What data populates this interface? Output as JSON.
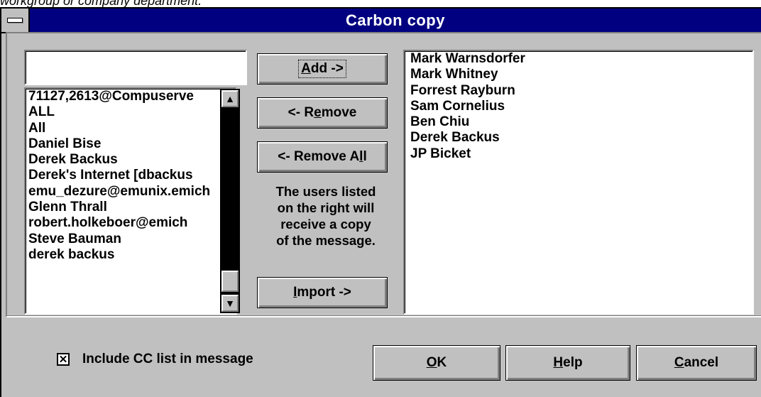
{
  "caption": "workgroup or company department.",
  "window": {
    "title": "Carbon copy"
  },
  "name_input": {
    "value": ""
  },
  "available_list": {
    "items": [
      "71127,2613@Compuserve",
      "ALL",
      "All",
      "Daniel Bise",
      "Derek Backus",
      "Derek's Internet   [dbackus",
      "emu_dezure@emunix.emich",
      "Glenn Thrall",
      "robert.holkeboer@emich",
      "Steve Bauman",
      "derek backus"
    ]
  },
  "buttons": {
    "add": {
      "pre": "",
      "key": "A",
      "post": "dd ->"
    },
    "remove": {
      "pre": "<- R",
      "key": "e",
      "post": "move"
    },
    "remove_all": {
      "pre": "<- Remove A",
      "key": "l",
      "post": "l"
    },
    "import": {
      "pre": "",
      "key": "I",
      "post": "mport ->"
    },
    "ok": {
      "pre": "",
      "key": "O",
      "post": "K"
    },
    "help": {
      "pre": "",
      "key": "H",
      "post": "elp"
    },
    "cancel": {
      "pre": "",
      "key": "C",
      "post": "ancel"
    }
  },
  "help_text": [
    "The users listed",
    "on the right will",
    "receive a copy",
    "of the message."
  ],
  "cc_list": {
    "items": [
      "Mark Warnsdorfer",
      "Mark Whitney",
      "Forrest Rayburn",
      "Sam Cornelius",
      "Ben Chiu",
      "Derek Backus",
      "JP Bicket"
    ]
  },
  "include_cc": {
    "label": "Include CC list in message",
    "checked": true,
    "mark": "✕"
  },
  "icons": {
    "scroll_up": "▲",
    "scroll_down": "▼"
  }
}
